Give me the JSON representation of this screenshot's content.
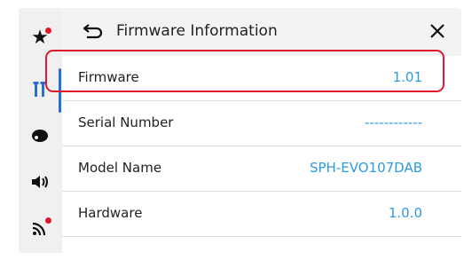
{
  "header": {
    "title": "Firmware Information",
    "back_icon": "back-arrow-icon",
    "close_icon": "close-icon"
  },
  "sidebar": {
    "items": [
      {
        "name": "favorites",
        "icon": "star-icon",
        "badge": true
      },
      {
        "name": "tools",
        "icon": "tools-icon",
        "active": true
      },
      {
        "name": "theme",
        "icon": "palette-icon"
      },
      {
        "name": "sound",
        "icon": "speaker-icon"
      },
      {
        "name": "connectivity",
        "icon": "wifi-icon",
        "badge": true
      }
    ]
  },
  "rows": [
    {
      "label": "Firmware",
      "value": "1.01",
      "highlighted": true
    },
    {
      "label": "Serial Number",
      "value": "------------"
    },
    {
      "label": "Model Name",
      "value": "SPH-EVO107DAB"
    },
    {
      "label": "Hardware",
      "value": "1.0.0"
    }
  ],
  "colors": {
    "accent": "#2a6fd6",
    "value_text": "#2d9be0",
    "highlight": "#e0182a",
    "badge": "#e0182a"
  }
}
